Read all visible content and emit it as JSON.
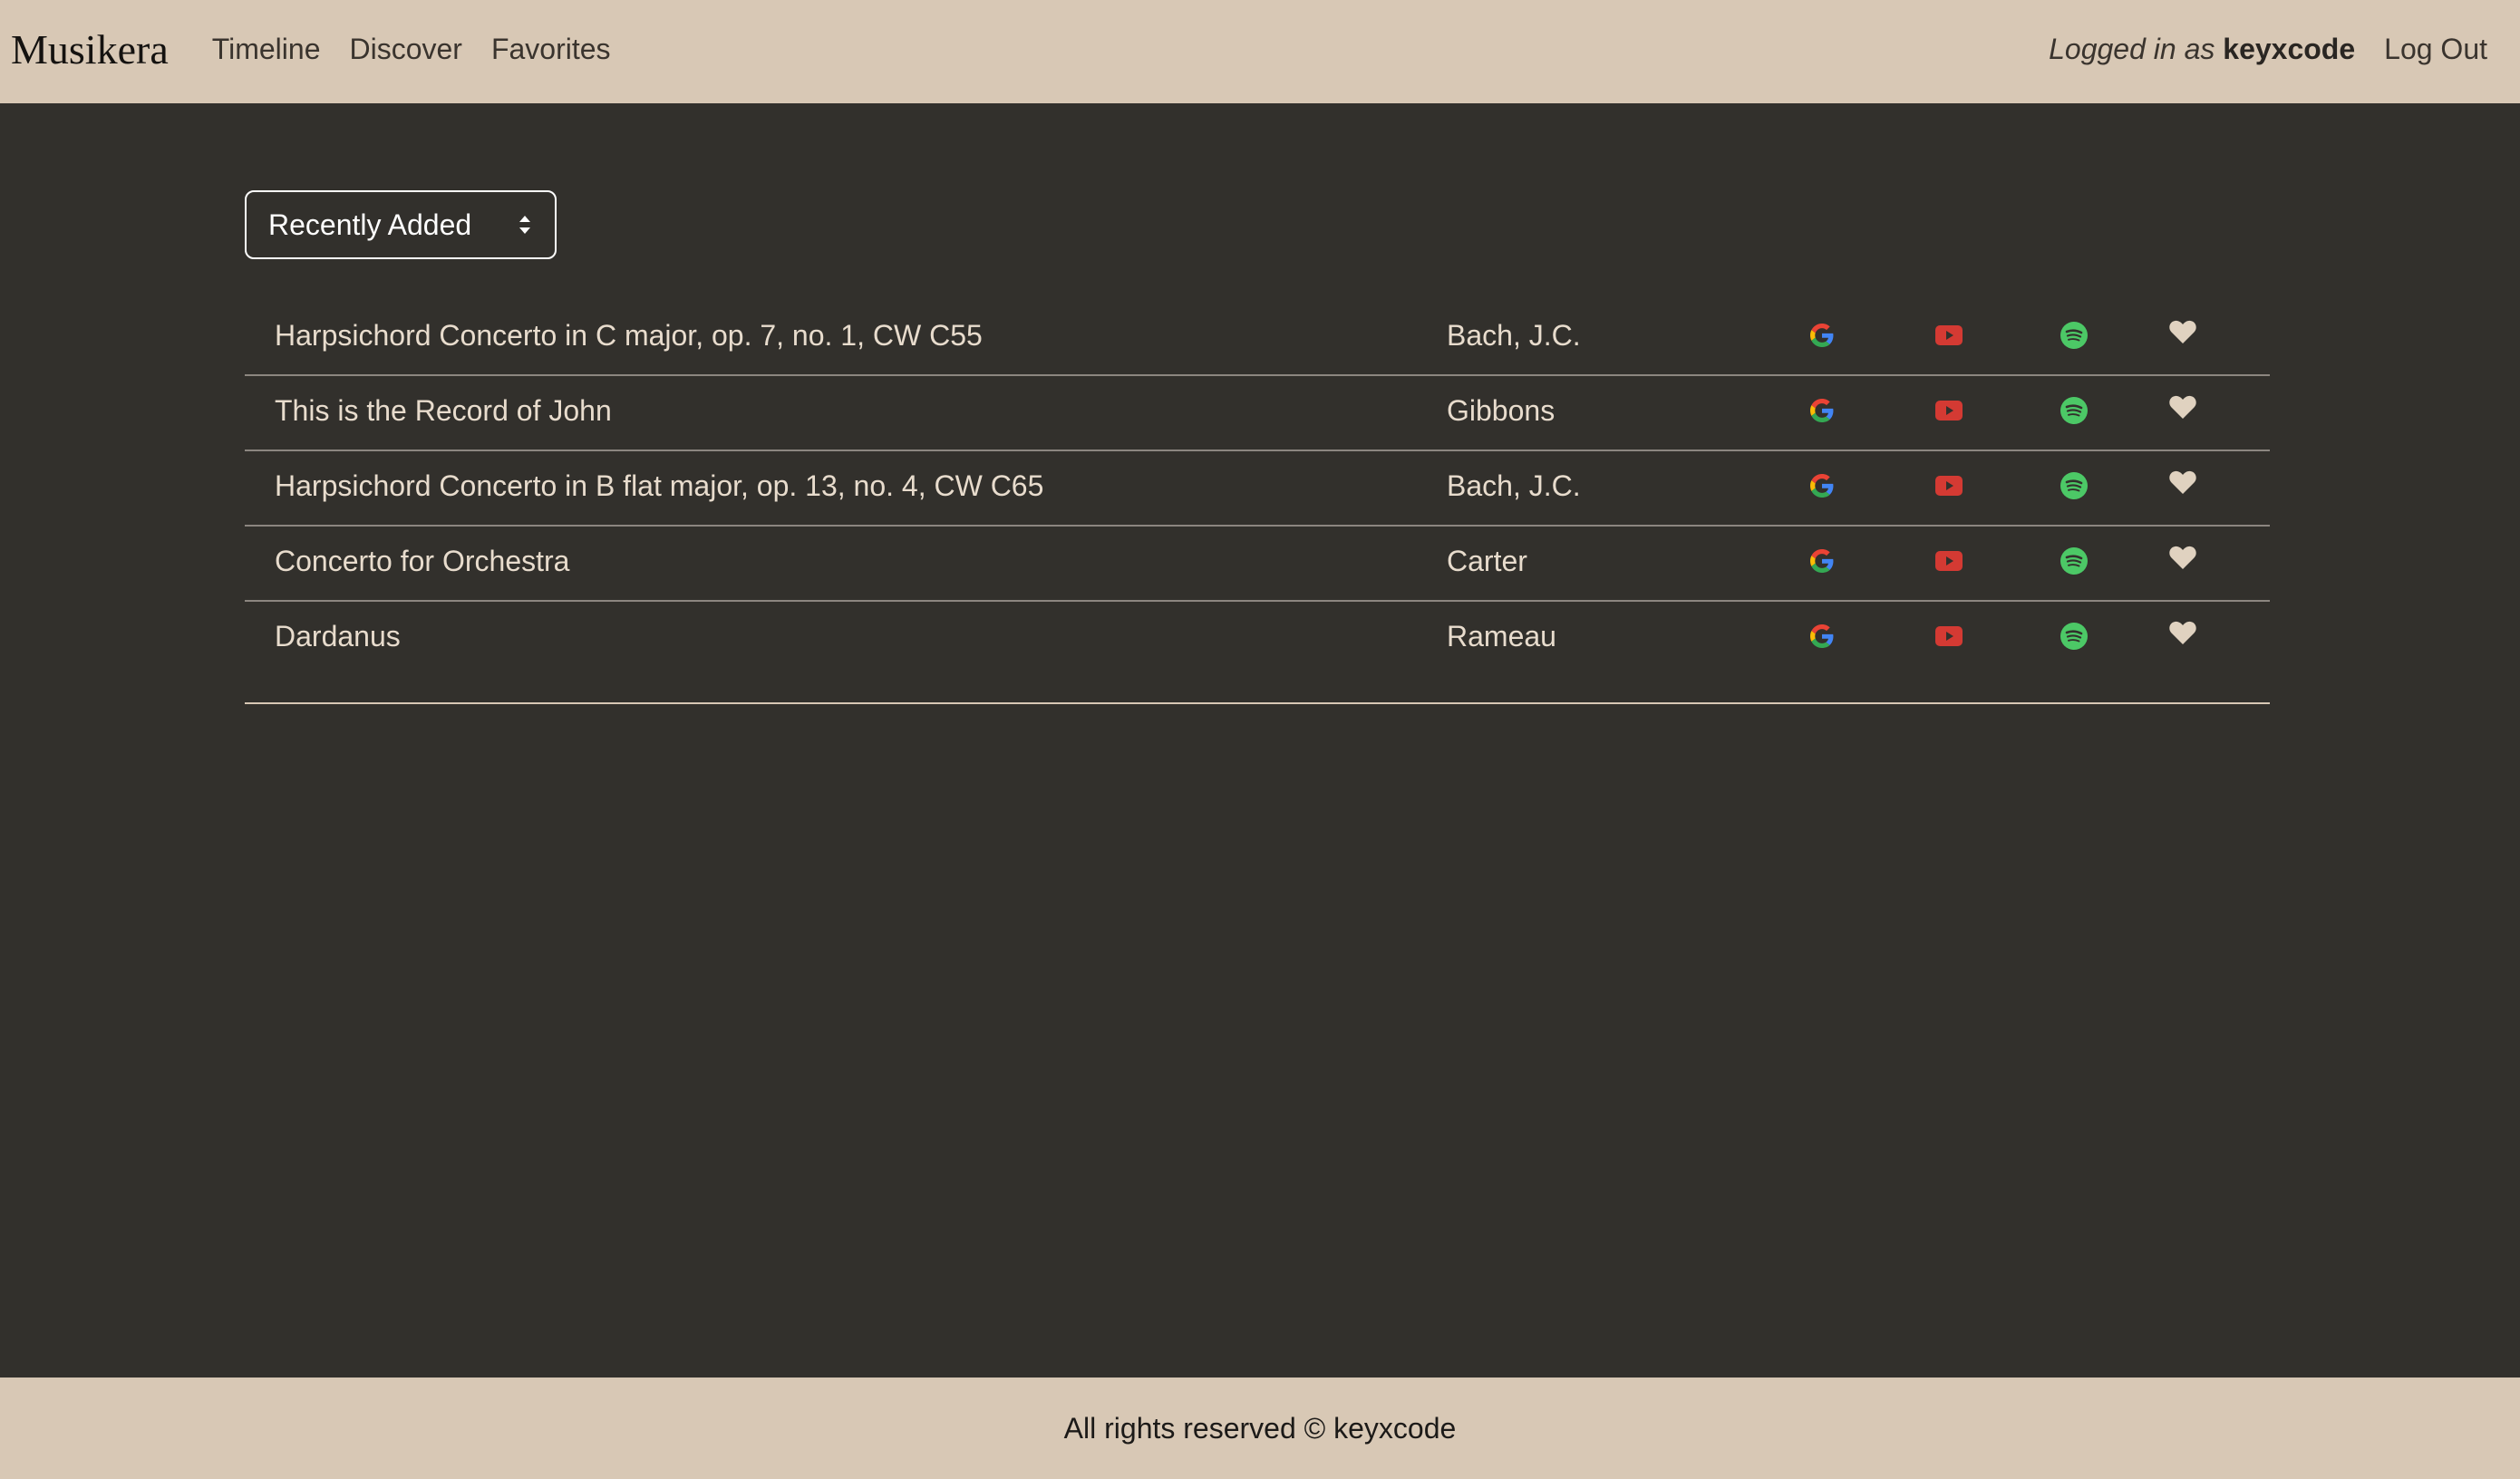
{
  "navbar": {
    "brand": "Musikera",
    "links": [
      "Timeline",
      "Discover",
      "Favorites"
    ],
    "login_prefix": "Logged in as",
    "username": "keyxcode",
    "logout_label": "Log Out"
  },
  "sort": {
    "selected": "Recently Added"
  },
  "works": [
    {
      "title": "Harpsichord Concerto in C major, op. 7, no. 1, CW C55",
      "composer": "Bach, J.C."
    },
    {
      "title": "This is the Record of John",
      "composer": "Gibbons"
    },
    {
      "title": "Harpsichord Concerto in B flat major, op. 13, no. 4, CW C65",
      "composer": "Bach, J.C."
    },
    {
      "title": "Concerto for Orchestra",
      "composer": "Carter"
    },
    {
      "title": "Dardanus",
      "composer": "Rameau"
    }
  ],
  "row_icons": [
    "google-icon",
    "youtube-icon",
    "spotify-icon",
    "heart-icon"
  ],
  "colors": {
    "navbar_bg": "#d8c8b5",
    "page_bg": "#32302c",
    "text_light": "#e8dccd",
    "youtube_red": "#d43a33",
    "spotify_green": "#4cc866",
    "heart": "#e0d2c0"
  },
  "footer": {
    "text": "All rights reserved © keyxcode"
  }
}
